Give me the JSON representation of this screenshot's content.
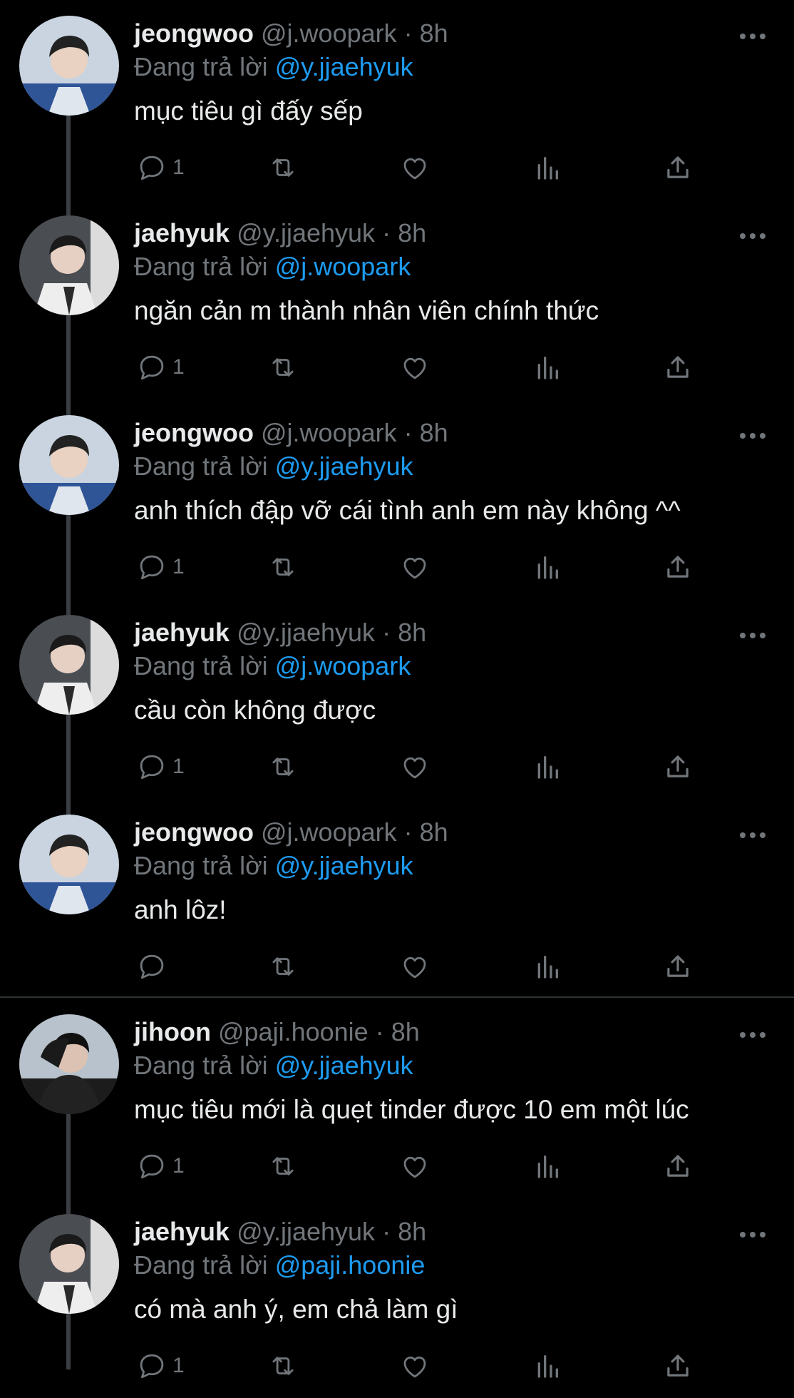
{
  "tweets": [
    {
      "name": "jeongwoo",
      "handle": "@j.woopark",
      "dot": "·",
      "time": "8h",
      "reply_prefix": "Đang trả lời",
      "reply_to": "@y.jjaehyuk",
      "text": "mục tiêu gì đấy sếp",
      "reply_count": "1",
      "avatar": "jeongwoo-avatar"
    },
    {
      "name": "jaehyuk",
      "handle": "@y.jjaehyuk",
      "dot": "·",
      "time": "8h",
      "reply_prefix": "Đang trả lời",
      "reply_to": "@j.woopark",
      "text": "ngăn cản m thành nhân viên chính thức",
      "reply_count": "1",
      "avatar": "jaehyuk-avatar"
    },
    {
      "name": "jeongwoo",
      "handle": "@j.woopark",
      "dot": "·",
      "time": "8h",
      "reply_prefix": "Đang trả lời",
      "reply_to": "@y.jjaehyuk",
      "text": "anh thích đập vỡ cái tình anh em này không ^^",
      "reply_count": "1",
      "avatar": "jeongwoo-avatar"
    },
    {
      "name": "jaehyuk",
      "handle": "@y.jjaehyuk",
      "dot": "·",
      "time": "8h",
      "reply_prefix": "Đang trả lời",
      "reply_to": "@j.woopark",
      "text": "cầu còn không được",
      "reply_count": "1",
      "avatar": "jaehyuk-avatar"
    },
    {
      "name": "jeongwoo",
      "handle": "@j.woopark",
      "dot": "·",
      "time": "8h",
      "reply_prefix": "Đang trả lời",
      "reply_to": "@y.jjaehyuk",
      "text": "anh lôz!",
      "reply_count": "",
      "avatar": "jeongwoo-avatar"
    },
    {
      "name": "jihoon",
      "handle": "@paji.hoonie",
      "dot": "·",
      "time": "8h",
      "reply_prefix": "Đang trả lời",
      "reply_to": "@y.jjaehyuk",
      "text": "mục tiêu mới là quẹt tinder được 10 em một lúc",
      "reply_count": "1",
      "avatar": "jihoon-avatar"
    },
    {
      "name": "jaehyuk",
      "handle": "@y.jjaehyuk",
      "dot": "·",
      "time": "8h",
      "reply_prefix": "Đang trả lời",
      "reply_to": "@paji.hoonie",
      "text": "có mà anh ý, em chả làm gì",
      "reply_count": "1",
      "avatar": "jaehyuk-avatar"
    }
  ],
  "icons": {
    "reply": "reply-icon",
    "retweet": "retweet-icon",
    "like": "like-icon",
    "views": "views-icon",
    "share": "share-icon",
    "more": "more-icon"
  },
  "colors": {
    "background": "#000000",
    "text": "#e7e9ea",
    "muted": "#71767b",
    "accent": "#1d9bf0"
  }
}
